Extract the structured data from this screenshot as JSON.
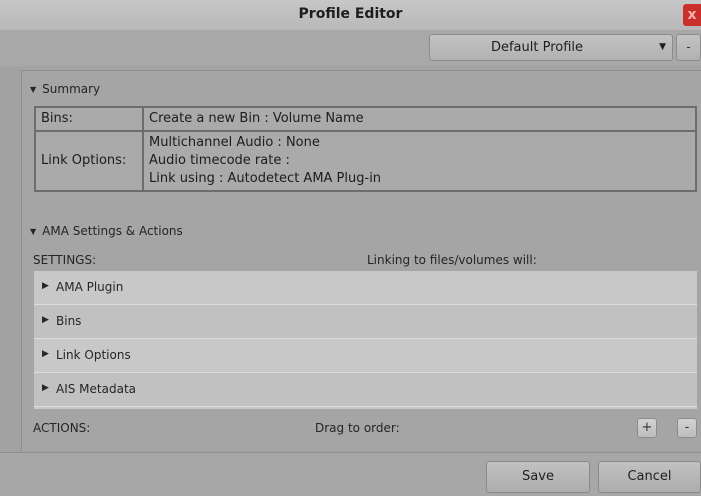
{
  "window": {
    "title": "Profile Editor",
    "close_glyph": "x"
  },
  "profile": {
    "selected": "Default Profile",
    "dropdown_icon": "chevron-down-icon",
    "minus_label": "-"
  },
  "summary": {
    "header": "Summary",
    "rows": [
      {
        "label": "Bins:",
        "lines": [
          "Create a new Bin : Volume Name"
        ]
      },
      {
        "label": "Link Options:",
        "lines": [
          "Multichannel Audio : None",
          "Audio timecode rate :",
          "Link using : Autodetect AMA Plug-in"
        ]
      }
    ]
  },
  "ama": {
    "header": "AMA Settings & Actions",
    "settings_label": "SETTINGS:",
    "linking_label": "Linking to files/volumes will:",
    "settings_items": [
      "AMA Plugin",
      "Bins",
      "Link Options",
      "AIS Metadata"
    ],
    "actions_label": "ACTIONS:",
    "drag_label": "Drag to order:",
    "add_label": "+",
    "remove_label": "-"
  },
  "buttons": {
    "save": "Save",
    "cancel": "Cancel"
  }
}
